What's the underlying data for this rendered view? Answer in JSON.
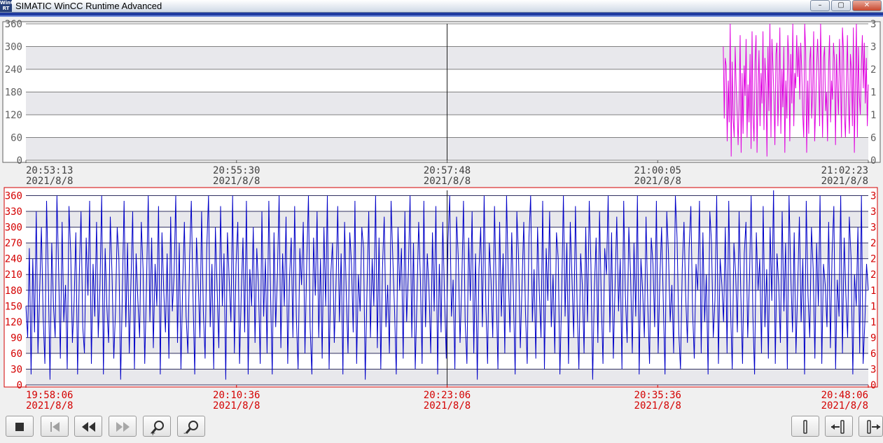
{
  "window": {
    "title": "SIMATIC WinCC Runtime Advanced",
    "icon_text": "WinCC RT",
    "buttons": [
      "–",
      "▢",
      "✕"
    ]
  },
  "colors": {
    "top_trend": "#e000e0",
    "bottom_trend": "#0000c8",
    "bottom_axis": "#d40000",
    "top_axis": "#606060",
    "band": "#e8e8ec",
    "accent": "#1f3a9f"
  },
  "toolbar": [
    {
      "name": "stop-button",
      "icon": "stop-icon"
    },
    {
      "name": "to-start-button",
      "icon": "skip-to-start-icon"
    },
    {
      "name": "scroll-back-button",
      "icon": "rewind-icon"
    },
    {
      "name": "scroll-forward-button",
      "icon": "fast-forward-icon"
    },
    {
      "name": "zoom-in-button",
      "icon": "zoom-in-icon"
    },
    {
      "name": "zoom-out-button",
      "icon": "zoom-out-icon"
    },
    {
      "name": "ruler-button",
      "icon": "ruler-icon"
    },
    {
      "name": "ruler-back-button",
      "icon": "ruler-back-icon"
    },
    {
      "name": "ruler-forward-button",
      "icon": "ruler-forward-icon"
    }
  ],
  "chart_data": [
    {
      "type": "line",
      "title": "",
      "ylim": [
        0,
        360
      ],
      "y_ticks": [
        "360",
        "300",
        "240",
        "180",
        "120",
        "60",
        "0"
      ],
      "y_tick_values": [
        360,
        300,
        240,
        180,
        120,
        60,
        0
      ],
      "x_ticks": [
        {
          "time": "20:53:13",
          "date": "2021/8/8"
        },
        {
          "time": "20:55:30",
          "date": "2021/8/8"
        },
        {
          "time": "20:57:48",
          "date": "2021/8/8"
        },
        {
          "time": "21:00:05",
          "date": "2021/8/8"
        },
        {
          "time": "21:02:23",
          "date": "2021/8/8"
        }
      ],
      "right_axis_digits": [
        "3",
        "3",
        "2",
        "1",
        "1",
        "6",
        "0"
      ],
      "grid": true,
      "series": [
        {
          "x_start": "21:01:07",
          "x_end": "21:02:23",
          "values": [
            300,
            110,
            270,
            250,
            50,
            210,
            100,
            360,
            10,
            260,
            110,
            60,
            300,
            200,
            130,
            40,
            160,
            330,
            20,
            230,
            70,
            250,
            170,
            320,
            60,
            200,
            100,
            280,
            30,
            340,
            120,
            50,
            260,
            330,
            20,
            180,
            290,
            90,
            230,
            150,
            340,
            80,
            270,
            200,
            10,
            300,
            130,
            360,
            60,
            320,
            250,
            170,
            40,
            280,
            310,
            90,
            190,
            350,
            70,
            240,
            140,
            300,
            20,
            210,
            110,
            330,
            260,
            50,
            280,
            150,
            360,
            90,
            230,
            190,
            330,
            220,
            300,
            160,
            310,
            240,
            120,
            60,
            360,
            290,
            20,
            210,
            70,
            260,
            300,
            110,
            180,
            340,
            50,
            140,
            250,
            320,
            230,
            90,
            360,
            200,
            60,
            270,
            300,
            130,
            180,
            50,
            240,
            330,
            100,
            210,
            160,
            310,
            260,
            40,
            280,
            190,
            120,
            320,
            220,
            60,
            350,
            290,
            120,
            60,
            210,
            330,
            150,
            70,
            280,
            240,
            90,
            350,
            20,
            210,
            360,
            60,
            300,
            170,
            120,
            250,
            330,
            190,
            310,
            150,
            270,
            90,
            200
          ]
        }
      ]
    },
    {
      "type": "line",
      "title": "",
      "ylim": [
        0,
        370
      ],
      "y_ticks": [
        "360",
        "330",
        "300",
        "270",
        "240",
        "210",
        "180",
        "150",
        "120",
        "90",
        "60",
        "30",
        "0"
      ],
      "y_tick_values": [
        360,
        330,
        300,
        270,
        240,
        210,
        180,
        150,
        120,
        90,
        60,
        30,
        0
      ],
      "x_ticks": [
        {
          "time": "19:58:06",
          "date": "2021/8/8"
        },
        {
          "time": "20:10:36",
          "date": "2021/8/8"
        },
        {
          "time": "20:23:06",
          "date": "2021/8/8"
        },
        {
          "time": "20:35:36",
          "date": "2021/8/8"
        },
        {
          "time": "20:48:06",
          "date": "2021/8/8"
        }
      ],
      "right_axis_digits": [
        "3",
        "3",
        "3",
        "2",
        "2",
        "2",
        "1",
        "1",
        "1",
        "9",
        "6",
        "3",
        "0"
      ],
      "grid": true,
      "series": [
        {
          "x_start": "19:58:06",
          "x_end": "20:48:25",
          "values": [
            150,
            90,
            260,
            20,
            240,
            100,
            330,
            60,
            180,
            300,
            130,
            40,
            350,
            200,
            10,
            270,
            150,
            90,
            360,
            220,
            50,
            310,
            120,
            190,
            30,
            340,
            250,
            80,
            160,
            290,
            20,
            210,
            330,
            110,
            60,
            280,
            170,
            350,
            40,
            230,
            130,
            310,
            90,
            190,
            360,
            20,
            260,
            150,
            80,
            320,
            210,
            50,
            140,
            300,
            240,
            10,
            180,
            350,
            110,
            270,
            60,
            200,
            330,
            30,
            250,
            160,
            90,
            310,
            220,
            40,
            190,
            360,
            120,
            280,
            70,
            230,
            150,
            340,
            20,
            290,
            180,
            100,
            250,
            50,
            320,
            140,
            210,
            360,
            80,
            270,
            30,
            190,
            310,
            130,
            60,
            240,
            350,
            170,
            20,
            280,
            200,
            90,
            330,
            140,
            50,
            260,
            360,
            110,
            230,
            30,
            300,
            180,
            70,
            340,
            150,
            250,
            10,
            290,
            200,
            120,
            360,
            60,
            230,
            310,
            40,
            170,
            280,
            100,
            350,
            20,
            220,
            150,
            300,
            80,
            260,
            190,
            40,
            330,
            130,
            240,
            60,
            350,
            180,
            20,
            290,
            110,
            210,
            360,
            70,
            250,
            150,
            320,
            40,
            200,
            280,
            90,
            340,
            130,
            30,
            260,
            190,
            310,
            60,
            230,
            360,
            110,
            20,
            280,
            170,
            330,
            90,
            240,
            50,
            300,
            150,
            360,
            30,
            210,
            270,
            80,
            190,
            340,
            120,
            250,
            20,
            310,
            170,
            60,
            290,
            230,
            100,
            350,
            40,
            210,
            140,
            300,
            260,
            10,
            180,
            330,
            90,
            240,
            150,
            360,
            70,
            280,
            30,
            220,
            320,
            110,
            190,
            60,
            350,
            240,
            140,
            20,
            300,
            180,
            260,
            50,
            330,
            120,
            210,
            360,
            90,
            270,
            30,
            160,
            310,
            200,
            40,
            350,
            110,
            250,
            180,
            60,
            290,
            140,
            340,
            20,
            230,
            100,
            310,
            170,
            50,
            270,
            360,
            130,
            200,
            30,
            320,
            240,
            80,
            190,
            350,
            120,
            40,
            280,
            160,
            330,
            60,
            250,
            10,
            220,
            300,
            110,
            360,
            150,
            40,
            270,
            200,
            90,
            340,
            180,
            30,
            310,
            130,
            250,
            60,
            360,
            210,
            100,
            290,
            170,
            20,
            330,
            240,
            70,
            190,
            310,
            140,
            40,
            280,
            360,
            120,
            220,
            50,
            300,
            180,
            90,
            350,
            30,
            260,
            160,
            330,
            110,
            210,
            60,
            290,
            240,
            20,
            170,
            360,
            130,
            270,
            40,
            310,
            200,
            90,
            340,
            150,
            30,
            250,
            190,
            60,
            300,
            120,
            350,
            230,
            10,
            180,
            280,
            80,
            330,
            160,
            40,
            260,
            210,
            360,
            100,
            290,
            50,
            190,
            320,
            140,
            240,
            30,
            350,
            170,
            80,
            300,
            210,
            60,
            270,
            130,
            360,
            20,
            240,
            180,
            90,
            320,
            150,
            40,
            280,
            230,
            110,
            350,
            60,
            200,
            300,
            160,
            20,
            330,
            250,
            120,
            190,
            60,
            360,
            280,
            100,
            30,
            220,
            310,
            170,
            80,
            260,
            340,
            140,
            50,
            230,
            180,
            350,
            60,
            290,
            120,
            210,
            20,
            330,
            270,
            90,
            160,
            360,
            40,
            240,
            190,
            120,
            300,
            60,
            350,
            150,
            30,
            270,
            210,
            100,
            330,
            170,
            40,
            250,
            310,
            90,
            200,
            360,
            130,
            20,
            290,
            180,
            240,
            60,
            340,
            110,
            220,
            50,
            300,
            160,
            380,
            40,
            250,
            190,
            80,
            330,
            140,
            270,
            30,
            360,
            210,
            100,
            290,
            60,
            180,
            320,
            120,
            240,
            20,
            350,
            170,
            90,
            300,
            220,
            50,
            270,
            150,
            360,
            40,
            230,
            190,
            110,
            310,
            70,
            250,
            340,
            30,
            200,
            130,
            360,
            60,
            280,
            170,
            90,
            320,
            240,
            20,
            210,
            150,
            300,
            60,
            360,
            40,
            120,
            230,
            180
          ]
        }
      ]
    }
  ]
}
